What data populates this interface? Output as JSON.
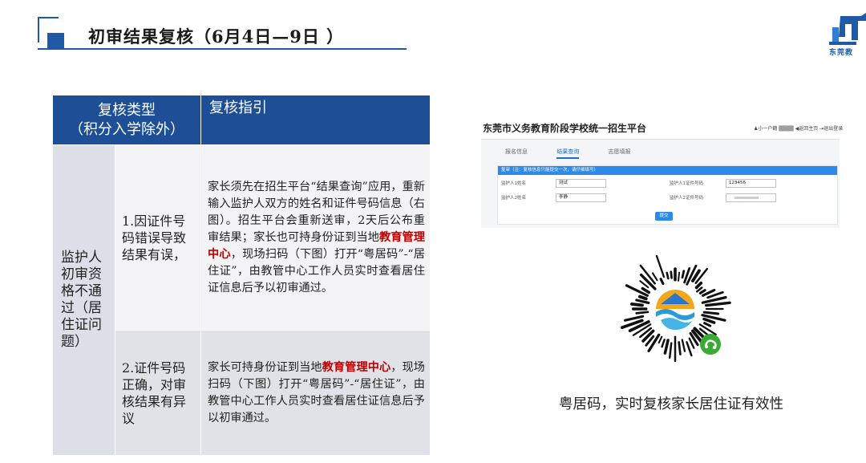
{
  "header": {
    "title": "初审结果复核（6月4日—9日 ）",
    "logo_text": "东莞教"
  },
  "table": {
    "col1_header_line1": "复核类型",
    "col1_header_line2": "（积分入学除外）",
    "col2_header": "复核指引",
    "category": "监护人初审资格不通过（居住证问题）",
    "rows": [
      {
        "case": "1.因证件号码错误导致结果有误，",
        "guide_part1": "家长须先在招生平台“结果查询”应用，重新输入监护人双方的姓名和证件号码信息（右图）。招生平台会重新送审，2天后公布重审结果；家长也可持身份证到当地",
        "guide_highlight": "教育管理中心",
        "guide_part2": "，现场扫码（下图）打开“粤居码”-“居住证”，由教管中心工作人员实时查看居住证信息后予以初审通过。"
      },
      {
        "case": "2.证件号码正确，对审核结果有异议",
        "guide_part1": "家长可持身份证到当地",
        "guide_highlight": "教育管理中心",
        "guide_part2": "，现场扫码（下图）打开“粤居码”-“居住证”，由教管中心工作人员实时查看居住证信息后予以初审通过。"
      }
    ]
  },
  "portal": {
    "title": "东莞市义务教育阶段学校统一招生平台",
    "user_info": "♟小一户籍 ▒▒▒▒   ◀返回主页   ⇥退出登录",
    "tabs": [
      "报名信息",
      "结果查询",
      "志愿填报"
    ],
    "active_tab": "结果查询",
    "bar_text": "复审（注：复核信息只能提交一次，请仔细填写）",
    "fields": [
      {
        "label": "监护人1姓名",
        "value": "测试"
      },
      {
        "label": "监护人1证件号码",
        "value": "123456"
      },
      {
        "label": "监护人2姓名",
        "value": "李静"
      },
      {
        "label": "监护人2证件号码",
        "value": ""
      }
    ],
    "submit_label": "提交"
  },
  "qr": {
    "caption": "粤居码，实时复核家长居住证有效性"
  },
  "colors": {
    "header_blue": "#1e4f96",
    "highlight_red": "#c00000",
    "portal_blue": "#2d8ae8",
    "qr_green": "#3aaa35"
  }
}
